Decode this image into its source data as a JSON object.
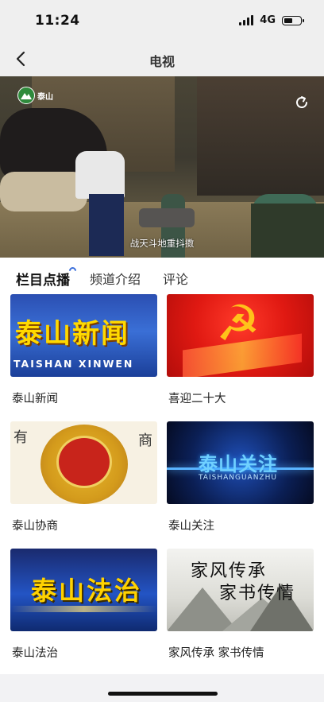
{
  "status_bar": {
    "time": "11:24",
    "network": "4G",
    "battery_level": 0.5
  },
  "nav": {
    "title": "电视",
    "back_icon": "chevron-left-icon"
  },
  "player": {
    "channel_logo_text": "泰山",
    "subtitle": "战天斗地重抖擞",
    "share_icon": "share-icon"
  },
  "tabs": [
    {
      "label": "栏目点播",
      "active": true
    },
    {
      "label": "频道介绍",
      "active": false
    },
    {
      "label": "评论",
      "active": false
    }
  ],
  "programs": [
    {
      "label": "泰山新闻",
      "thumb_title": "泰山新闻",
      "thumb_subtitle": "TAISHAN XINWEN"
    },
    {
      "label": "喜迎二十大"
    },
    {
      "label": "泰山协商",
      "thumb_text_left": "有",
      "thumb_text_right": "商"
    },
    {
      "label": "泰山关注",
      "thumb_title": "泰山关注",
      "thumb_subtitle": "TAISHANGUANZHU"
    },
    {
      "label": "泰山法治",
      "thumb_title": "泰山法治"
    },
    {
      "label": "家风传承 家书传情",
      "thumb_line1": "家风传承",
      "thumb_line2": "家书传情"
    }
  ],
  "colors": {
    "accent": "#3a6edb",
    "header_bg": "#efefef",
    "page_bg": "#f2f2f4"
  }
}
